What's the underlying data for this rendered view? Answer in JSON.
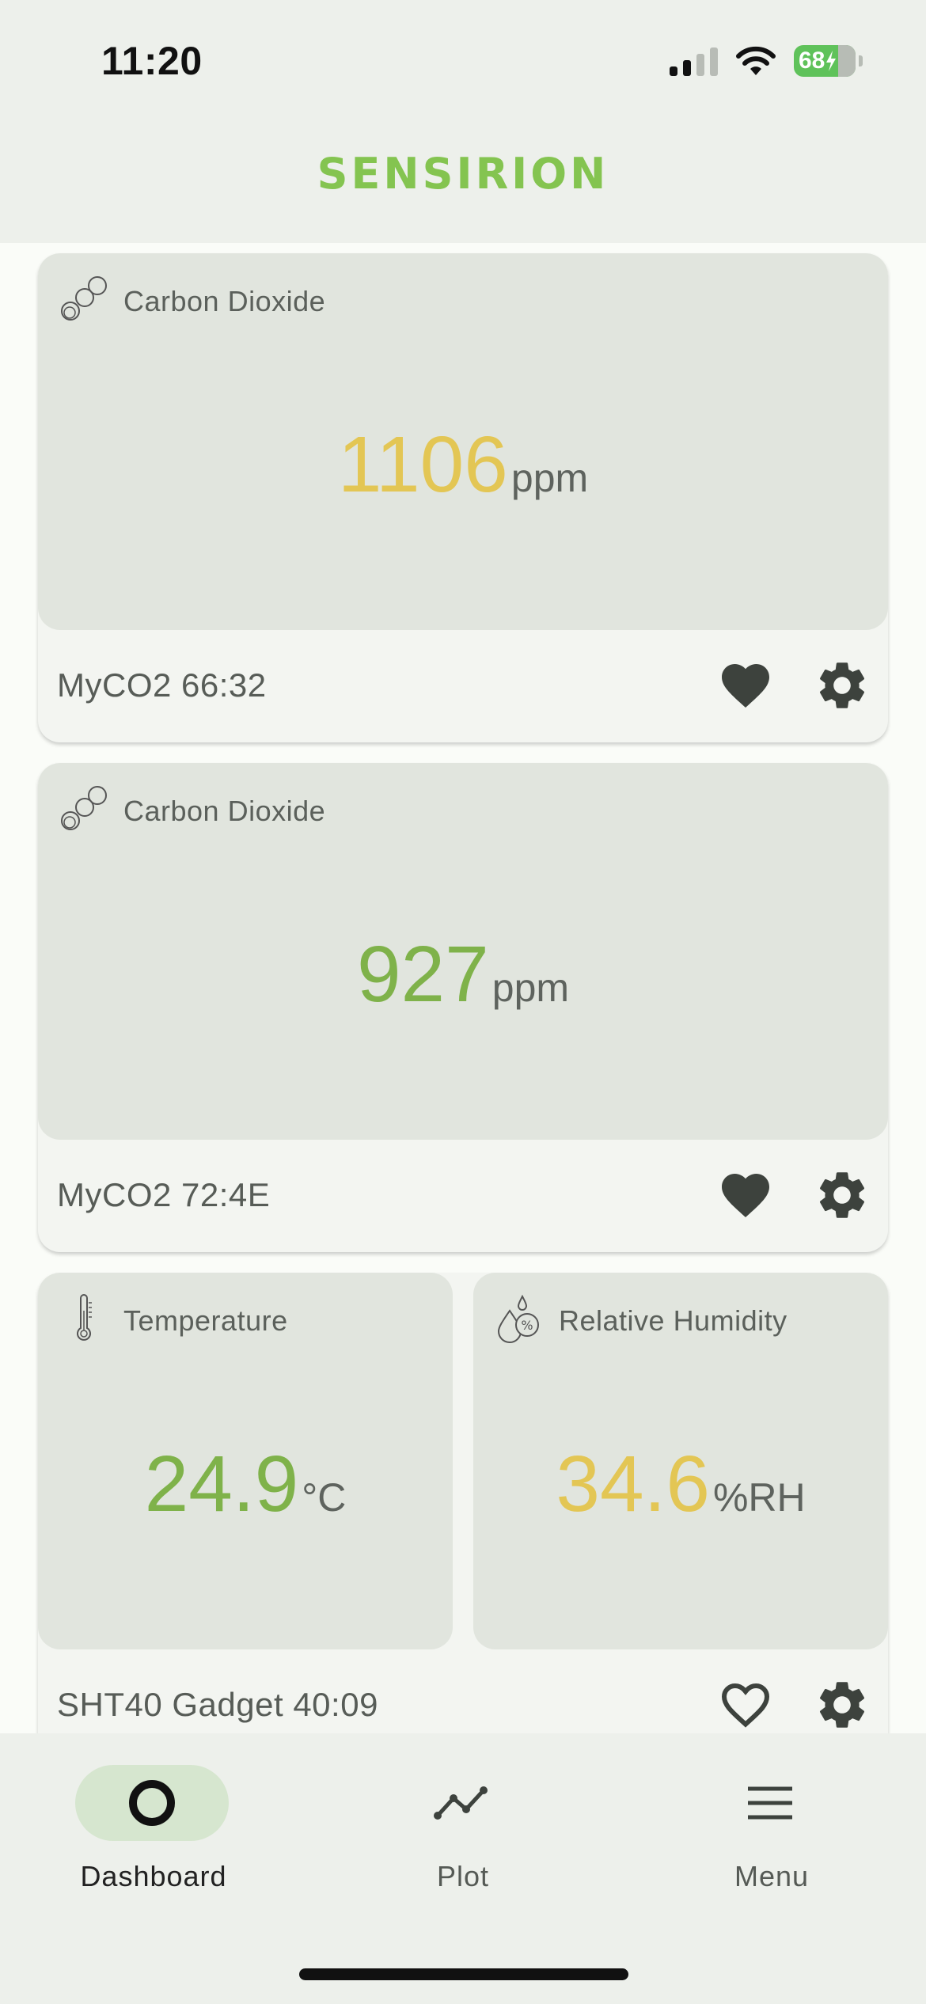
{
  "status_bar": {
    "time": "11:20",
    "battery": "68"
  },
  "brand": {
    "logo": "SENSIRION",
    "color": "#84c450"
  },
  "cards": [
    {
      "tiles": [
        {
          "label": "Carbon Dioxide",
          "icon": "molecule-icon",
          "value": "1106",
          "unit": "ppm",
          "status_color": "#e3c654"
        }
      ],
      "device": "MyCO2 66:32",
      "favorite": true
    },
    {
      "tiles": [
        {
          "label": "Carbon Dioxide",
          "icon": "molecule-icon",
          "value": "927",
          "unit": "ppm",
          "status_color": "#7fb24a"
        }
      ],
      "device": "MyCO2 72:4E",
      "favorite": true
    },
    {
      "tiles": [
        {
          "label": "Temperature",
          "icon": "thermometer-icon",
          "value": "24.9",
          "unit": "°C",
          "status_color": "#7fb24a"
        },
        {
          "label": "Relative Humidity",
          "icon": "humidity-icon",
          "value": "34.6",
          "unit": "%RH",
          "status_color": "#e3c654"
        }
      ],
      "device": "SHT40 Gadget 40:09",
      "favorite": false
    }
  ],
  "nav": {
    "items": [
      {
        "label": "Dashboard",
        "icon": "dashboard-circle-icon",
        "active": true
      },
      {
        "label": "Plot",
        "icon": "line-plot-icon",
        "active": false
      },
      {
        "label": "Menu",
        "icon": "hamburger-menu-icon",
        "active": false
      }
    ]
  }
}
